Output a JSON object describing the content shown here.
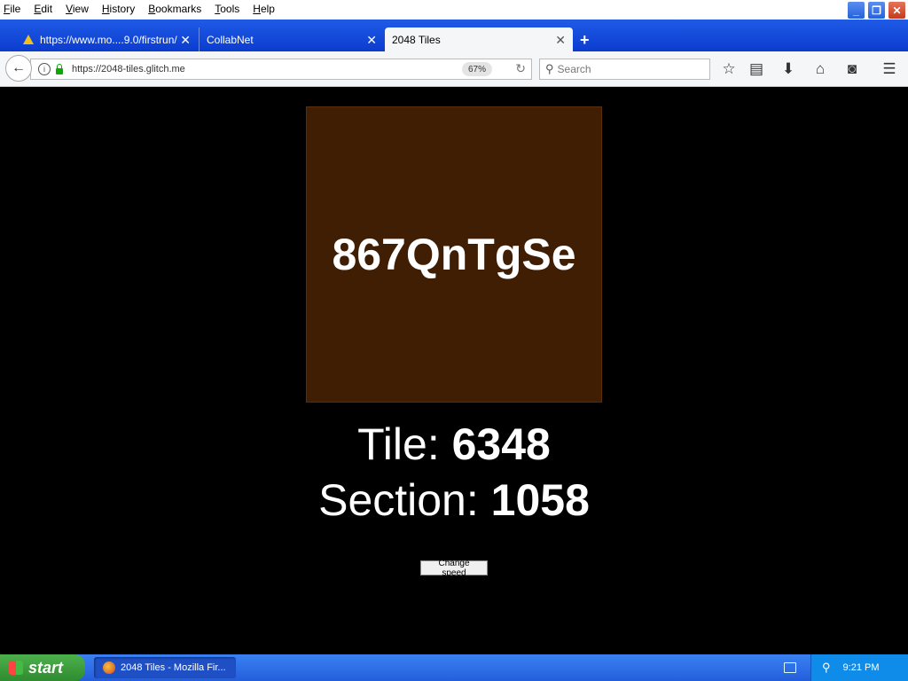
{
  "menubar": {
    "items": [
      "File",
      "Edit",
      "View",
      "History",
      "Bookmarks",
      "Tools",
      "Help"
    ]
  },
  "tabs": [
    {
      "label": "https://www.mo....9.0/firstrun/"
    },
    {
      "label": "CollabNet"
    },
    {
      "label": "2048 Tiles"
    }
  ],
  "navbar": {
    "url": "https://2048-tiles.glitch.me",
    "zoom": "67%",
    "search_placeholder": "Search"
  },
  "page": {
    "tile_text": "867QnTgSe",
    "tile_color": "#3f1e04",
    "tile_label": "Tile: ",
    "tile_value": "6348",
    "section_label": "Section: ",
    "section_value": "1058",
    "button_label": "Change speed"
  },
  "taskbar": {
    "start_label": "start",
    "window_label": "2048 Tiles - Mozilla Fir...",
    "clock": "9:21 PM"
  }
}
